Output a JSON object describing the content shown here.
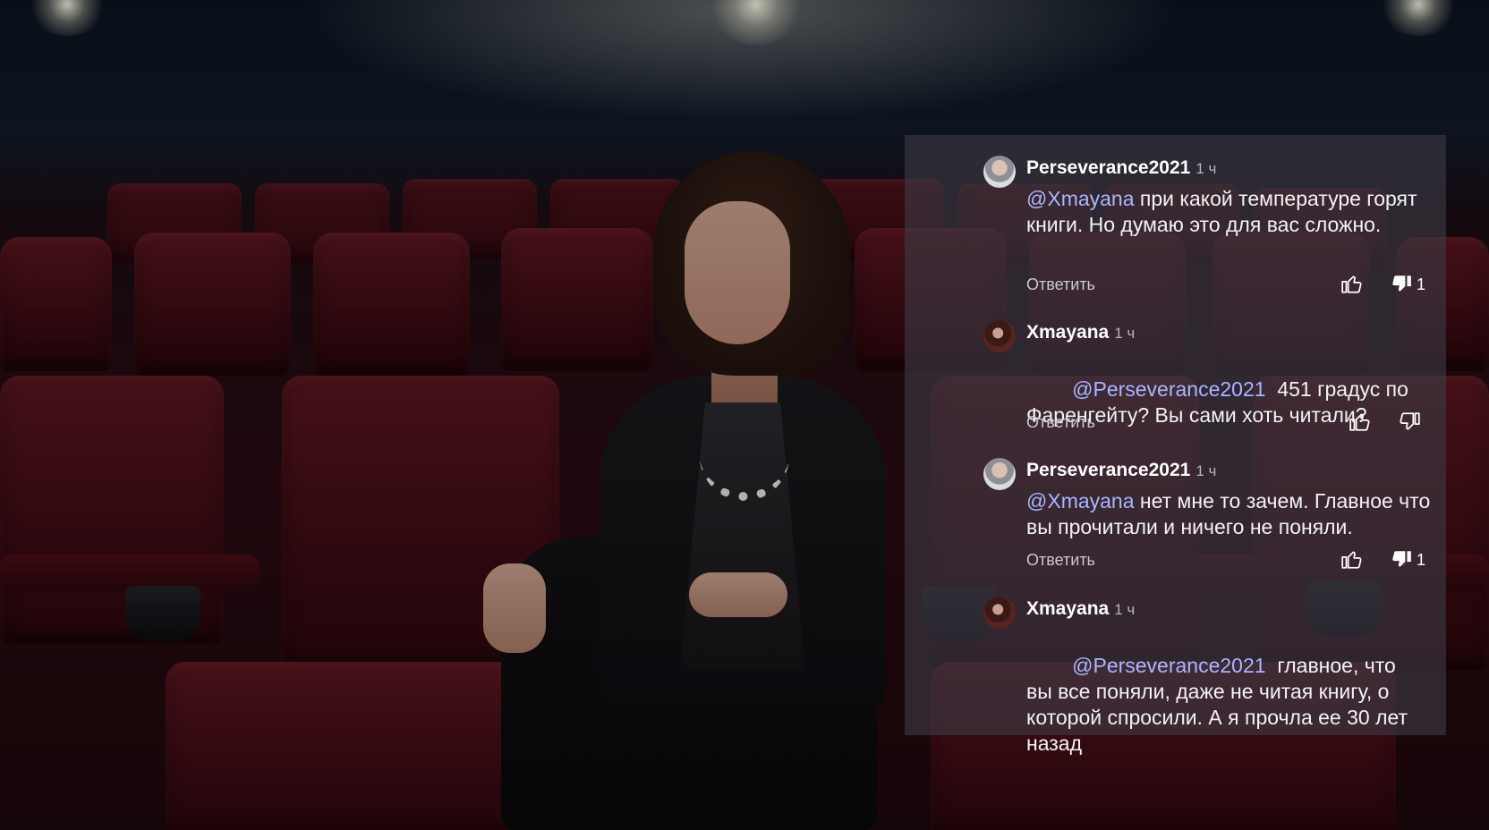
{
  "comments": [
    {
      "author": "Perseverance2021",
      "time": "1 ч",
      "mention": "@Xmayana",
      "body": " при какой температуре горят книги. Но думаю это для вас сложно.",
      "reply_label": "Ответить",
      "dislike_count": "1",
      "avatar_icon": "user-avatar-man-icon"
    },
    {
      "author": "Xmayana",
      "time": "1 ч",
      "mention": "@Perseverance2021",
      "body": "  451 градус по Фаренгейту? Вы сами хоть читали?",
      "reply_label": "Ответить",
      "dislike_count": "",
      "avatar_icon": "user-avatar-woman-icon"
    },
    {
      "author": "Perseverance2021",
      "time": "1 ч",
      "mention": "@Xmayana",
      "body": " нет мне то зачем. Главное что вы прочитали и ничего не поняли.",
      "reply_label": "Ответить",
      "dislike_count": "1",
      "avatar_icon": "user-avatar-man-icon"
    },
    {
      "author": "Xmayana",
      "time": "1 ч",
      "mention": "@Perseverance2021",
      "body": "  главное, что вы все поняли, даже не читая книгу, о которой спросили. А я прочла ее 30 лет назад",
      "avatar_icon": "user-avatar-woman-icon"
    }
  ],
  "colors": {
    "mention": "#a9b6ff",
    "panel_bg": "rgba(62,58,70,0.62)",
    "seat_red": "#5a1620"
  },
  "background": "cinema-hall-woman-in-black-suit-photo"
}
